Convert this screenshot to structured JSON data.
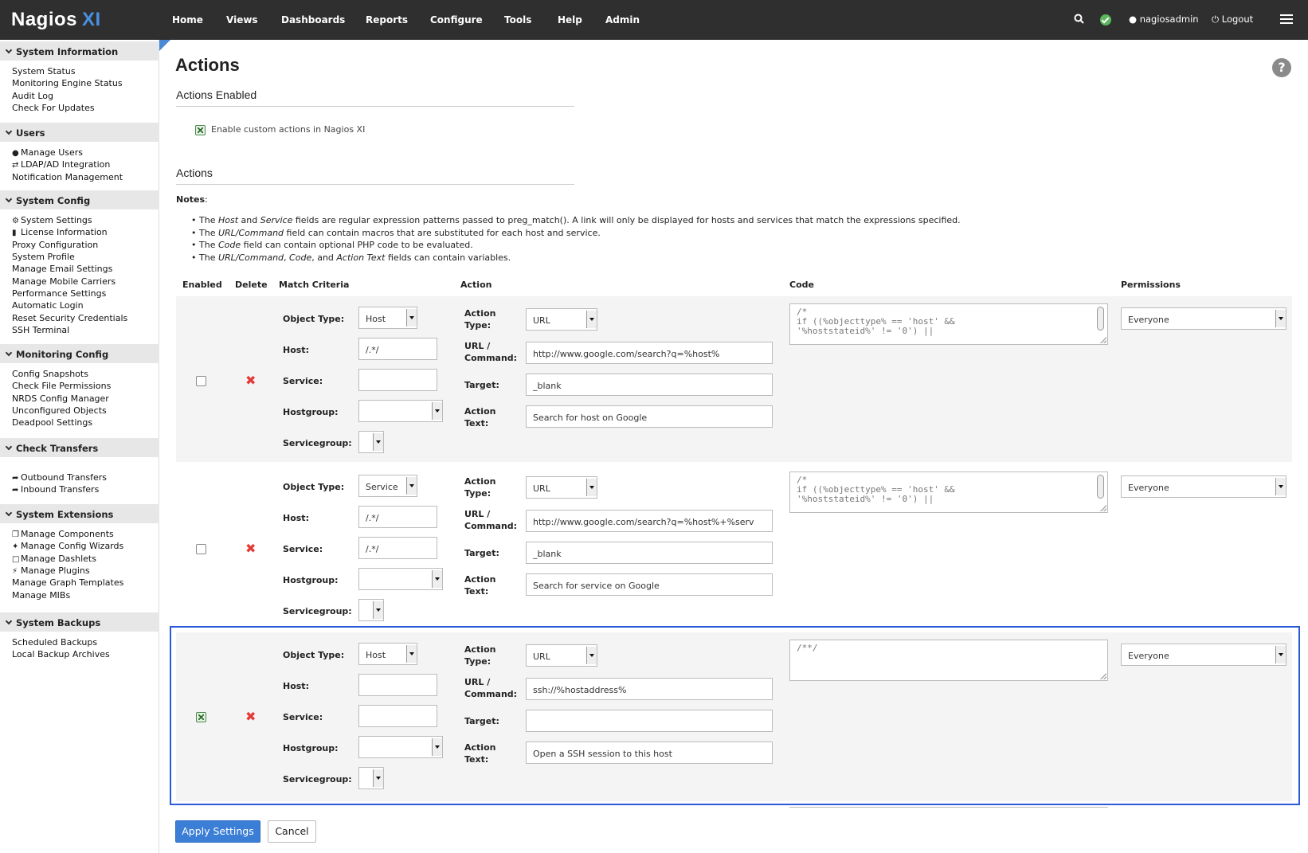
{
  "header": {
    "logo_main": "Nagios",
    "logo_xi": "XI",
    "nav": [
      "Home",
      "Views",
      "Dashboards",
      "Reports",
      "Configure",
      "Tools",
      "Help",
      "Admin"
    ],
    "user": "nagiosadmin",
    "logout": "Logout"
  },
  "sidebar": {
    "sections": [
      {
        "title": "System Information",
        "items": [
          "System Status",
          "Monitoring Engine Status",
          "Audit Log",
          "Check For Updates"
        ]
      },
      {
        "title": "Users",
        "items": [
          "Manage Users",
          "LDAP/AD Integration",
          "Notification Management"
        ]
      },
      {
        "title": "System Config",
        "items": [
          "System Settings",
          "License Information",
          "Proxy Configuration",
          "System Profile",
          "Manage Email Settings",
          "Manage Mobile Carriers",
          "Performance Settings",
          "Automatic Login",
          "Reset Security Credentials",
          "SSH Terminal"
        ]
      },
      {
        "title": "Monitoring Config",
        "items": [
          "Config Snapshots",
          "Check File Permissions",
          "NRDS Config Manager",
          "Unconfigured Objects",
          "Deadpool Settings"
        ]
      },
      {
        "title": "Check Transfers",
        "items": [
          "Outbound Transfers",
          "Inbound Transfers"
        ]
      },
      {
        "title": "System Extensions",
        "items": [
          "Manage Components",
          "Manage Config Wizards",
          "Manage Dashlets",
          "Manage Plugins",
          "Manage Graph Templates",
          "Manage MIBs"
        ]
      },
      {
        "title": "System Backups",
        "items": [
          "Scheduled Backups",
          "Local Backup Archives"
        ]
      }
    ]
  },
  "main": {
    "title": "Actions",
    "enabled_heading": "Actions Enabled",
    "enable_label": "Enable custom actions in Nagios XI",
    "enable_checked": true,
    "actions_heading": "Actions",
    "notes_label": "Notes",
    "notes": [
      [
        "The ",
        "Host",
        " and ",
        "Service",
        " fields are regular expression patterns passed to preg_match(). A link will only be displayed for hosts and services that match the expressions specified."
      ],
      [
        "The ",
        "URL/Command",
        " field can contain macros that are substituted for each host and service."
      ],
      [
        "The ",
        "Code",
        " field can contain optional PHP code to be evaluated."
      ],
      [
        "The ",
        "URL/Command",
        ", ",
        "Code",
        ", and ",
        "Action Text",
        " fields can contain variables."
      ]
    ],
    "columns": {
      "enabled": "Enabled",
      "delete": "Delete",
      "match": "Match Criteria",
      "action": "Action",
      "code": "Code",
      "permissions": "Permissions"
    },
    "field_labels": {
      "object_type": "Object Type:",
      "host": "Host:",
      "service": "Service:",
      "hostgroup": "Hostgroup:",
      "servicegroup": "Servicegroup:",
      "action_type": "Action Type:",
      "url_command": "URL / Command:",
      "target": "Target:",
      "action_text": "Action Text:"
    },
    "rows": [
      {
        "enabled": false,
        "object_type": "Host",
        "host": "/.*/",
        "service": "",
        "hostgroup": "",
        "servicegroup": "",
        "action_type": "URL",
        "url": "http://www.google.com/search?q=%host%",
        "target": "_blank",
        "action_text": "Search for host on Google",
        "code": "/*\nif ((%objecttype% == 'host' &&\n'%hoststateid%' != '0') ||",
        "permissions": "Everyone"
      },
      {
        "enabled": false,
        "object_type": "Service",
        "host": "/.*/",
        "service": "/.*/",
        "hostgroup": "",
        "servicegroup": "",
        "action_type": "URL",
        "url": "http://www.google.com/search?q=%host%+%serv",
        "target": "_blank",
        "action_text": "Search for service on Google",
        "code": "/*\nif ((%objecttype% == 'host' &&\n'%hoststateid%' != '0') ||",
        "permissions": "Everyone"
      },
      {
        "enabled": true,
        "object_type": "Host",
        "host": "",
        "service": "",
        "hostgroup": "",
        "servicegroup": "",
        "action_type": "URL",
        "url": "ssh://%hostaddress%",
        "target": "",
        "action_text": "Open a SSH session to this host",
        "code": "/**/",
        "permissions": "Everyone"
      }
    ],
    "apply_label": "Apply Settings",
    "cancel_label": "Cancel"
  },
  "colors": {
    "topbar": "#2f2f2f",
    "accent": "#3b7ed6",
    "delete": "#e53935",
    "selection": "#2a5bd7"
  }
}
